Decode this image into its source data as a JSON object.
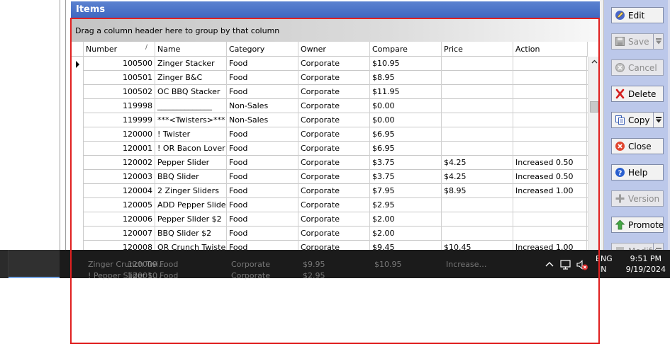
{
  "panel": {
    "title": "Items",
    "group_hint": "Drag a column header here to group by that column"
  },
  "columns": [
    "Number",
    "Name",
    "Category",
    "Owner",
    "Compare",
    "Price",
    "Action"
  ],
  "sort": {
    "column": "Number",
    "glyph": "/"
  },
  "rows": [
    {
      "number": "100500",
      "name": "Zinger Stacker",
      "category": "Food",
      "owner": "Corporate",
      "compare": "$10.95",
      "price": "",
      "action": ""
    },
    {
      "number": "100501",
      "name": "Zinger B&C",
      "category": "Food",
      "owner": "Corporate",
      "compare": "$8.95",
      "price": "",
      "action": ""
    },
    {
      "number": "100502",
      "name": "OC BBQ Stacker",
      "category": "Food",
      "owner": "Corporate",
      "compare": "$11.95",
      "price": "",
      "action": ""
    },
    {
      "number": "119998",
      "name": "______________",
      "category": "Non-Sales",
      "owner": "Corporate",
      "compare": "$0.00",
      "price": "",
      "action": ""
    },
    {
      "number": "119999",
      "name": "***<Twisters>***",
      "category": "Non-Sales",
      "owner": "Corporate",
      "compare": "$0.00",
      "price": "",
      "action": ""
    },
    {
      "number": "120000",
      "name": "! Twister",
      "category": "Food",
      "owner": "Corporate",
      "compare": "$6.95",
      "price": "",
      "action": ""
    },
    {
      "number": "120001",
      "name": "! OR Bacon Lover…",
      "category": "Food",
      "owner": "Corporate",
      "compare": "$6.95",
      "price": "",
      "action": ""
    },
    {
      "number": "120002",
      "name": "Pepper Slider",
      "category": "Food",
      "owner": "Corporate",
      "compare": "$3.75",
      "price": "$4.25",
      "action": "Increased 0.50"
    },
    {
      "number": "120003",
      "name": "BBQ Slider",
      "category": "Food",
      "owner": "Corporate",
      "compare": "$3.75",
      "price": "$4.25",
      "action": "Increased 0.50"
    },
    {
      "number": "120004",
      "name": "2 Zinger Sliders",
      "category": "Food",
      "owner": "Corporate",
      "compare": "$7.95",
      "price": "$8.95",
      "action": "Increased 1.00"
    },
    {
      "number": "120005",
      "name": "ADD Pepper Slider",
      "category": "Food",
      "owner": "Corporate",
      "compare": "$2.95",
      "price": "",
      "action": ""
    },
    {
      "number": "120006",
      "name": "Pepper Slider $2",
      "category": "Food",
      "owner": "Corporate",
      "compare": "$2.00",
      "price": "",
      "action": ""
    },
    {
      "number": "120007",
      "name": "BBQ Slider $2",
      "category": "Food",
      "owner": "Corporate",
      "compare": "$2.00",
      "price": "",
      "action": ""
    },
    {
      "number": "120008",
      "name": "OR Crunch Twister",
      "category": "Food",
      "owner": "Corporate",
      "compare": "$9.45",
      "price": "$10.45",
      "action": "Increased 1.00"
    }
  ],
  "ghost_rows": [
    {
      "number": "120009",
      "name": "Zinger Crunch Twi…",
      "category": "Food",
      "owner": "Corporate",
      "compare": "$9.95",
      "price": "$10.95",
      "action": "Increase…"
    },
    {
      "number": "120010",
      "name": "! Pepper Slider $…",
      "category": "Food",
      "owner": "Corporate",
      "compare": "$2.95",
      "price": "",
      "action": ""
    }
  ],
  "actions": [
    {
      "label": "Edit",
      "icon": "edit-icon",
      "enabled": true,
      "split": false
    },
    {
      "label": "Save",
      "icon": "save-icon",
      "enabled": false,
      "split": true
    },
    {
      "label": "Cancel",
      "icon": "cancel-icon",
      "enabled": false,
      "split": false
    },
    {
      "label": "Delete",
      "icon": "delete-icon",
      "enabled": true,
      "split": false
    },
    {
      "label": "Copy",
      "icon": "copy-icon",
      "enabled": true,
      "split": true
    },
    {
      "label": "Close",
      "icon": "close-icon",
      "enabled": true,
      "split": false
    },
    {
      "label": "Help",
      "icon": "help-icon",
      "enabled": true,
      "split": false
    },
    {
      "label": "Version",
      "icon": "version-icon",
      "enabled": false,
      "split": false
    },
    {
      "label": "Promote",
      "icon": "promote-icon",
      "enabled": true,
      "split": false
    },
    {
      "label": "Modify",
      "icon": "modify-icon",
      "enabled": false,
      "split": true
    }
  ],
  "taskbar": {
    "language": "ENG",
    "region": "IN",
    "time": "9:51 PM",
    "date": "9/19/2024"
  },
  "colors": {
    "header_blue": "#3e66c0",
    "button_panel": "#bcc8ea",
    "selection_outline": "#e02020",
    "taskbar": "#1b1b1b"
  }
}
